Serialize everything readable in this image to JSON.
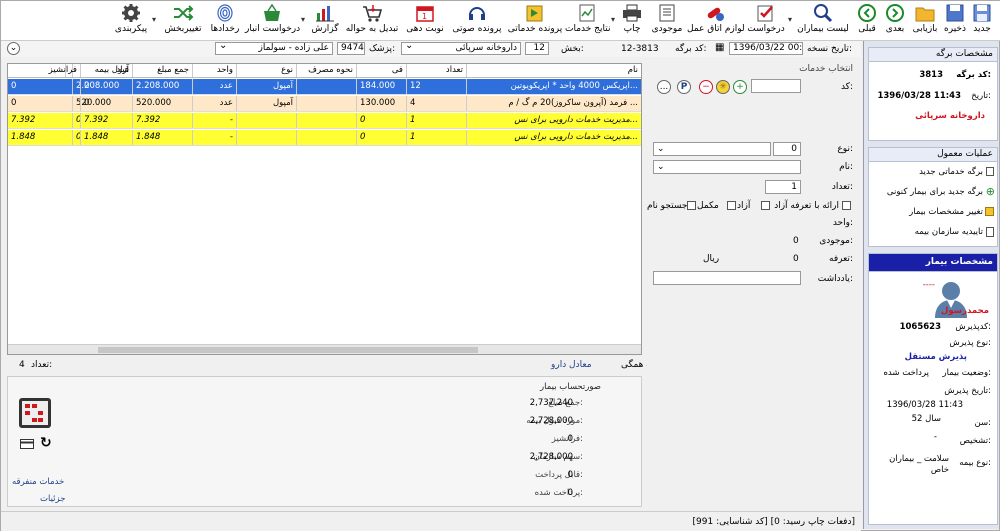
{
  "toolbar": {
    "items": [
      {
        "label": "جدید",
        "icon": "new-icon"
      },
      {
        "label": "ذخیره",
        "icon": "save-icon"
      },
      {
        "label": "بازیابی",
        "icon": "folder-icon"
      },
      {
        "label": "بعدی",
        "icon": "next-icon"
      },
      {
        "label": "قبلی",
        "icon": "previous-icon"
      },
      {
        "label": "لیست بیماران",
        "icon": "search-icon"
      },
      {
        "label": "درخواست",
        "icon": "request-icon"
      },
      {
        "label": "لوازم اتاق عمل",
        "icon": "pills-icon"
      },
      {
        "label": "موجودی",
        "icon": "inventory-icon"
      },
      {
        "label": "چاپ",
        "icon": "print-icon"
      },
      {
        "label": "نتایج خدمات",
        "icon": "results-icon"
      },
      {
        "label": "پرونده خدماتی",
        "icon": "service-file-icon"
      },
      {
        "label": "پرونده صوتی",
        "icon": "headset-icon"
      },
      {
        "label": "نوبت دهی",
        "icon": "calendar-icon"
      },
      {
        "label": "تبدیل به حواله",
        "icon": "cart-icon"
      },
      {
        "label": "گزارش",
        "icon": "chart-icon"
      },
      {
        "label": "درخواست انبار",
        "icon": "basket-icon"
      },
      {
        "label": "رخدادها",
        "icon": "fingerprint-icon"
      },
      {
        "label": "تغییربخش",
        "icon": "shuffle-icon"
      },
      {
        "label": "پیکربندی",
        "icon": "gear-icon"
      }
    ]
  },
  "header": {
    "version_date_label": "تاریخ نسخه:",
    "version_date": "1396/03/22 00:00",
    "sheet_code_label": "کد برگه:",
    "sheet_code": "12-3813",
    "ward_label": "بخش:",
    "ward_code": "12",
    "ward_name": "داروخانه سرپائی",
    "doctor_label": "پزشک:",
    "doctor_code": "9474",
    "doctor_name": "علی زاده - سولماز"
  },
  "grid": {
    "columns": [
      "نام",
      "تعداد",
      "فی",
      "نحوه مصرف",
      "نوع",
      "واحد",
      "جمع مبلغ",
      "قبول بیمه",
      "آزاد",
      "فرانشیز"
    ],
    "rows": [
      {
        "name": "اپریکس 4000 واحد * اپریکویوتین...",
        "count": "12",
        "price": "184.000",
        "usage": "",
        "type": "",
        "unit": "",
        "total": "2.208.000",
        "insurance": "2.208.000",
        "free": "0",
        "franchise": "0",
        "style": "selected"
      },
      {
        "name": "فرمد (آپرون ساکروز)20 م گ / م ...",
        "count": "4",
        "price": "130.000",
        "usage": "",
        "type": "آمپول",
        "unit": "عدد",
        "total": "520.000",
        "insurance": "520.000",
        "free": "0",
        "franchise": "0",
        "style": "peach"
      },
      {
        "name": "مدیریت خدمات دارویی برای نس...",
        "count": "1",
        "price": "0",
        "usage": "",
        "type": "",
        "unit": "-",
        "total": "7.392",
        "insurance": "0",
        "free": "7.392",
        "franchise": "7.392",
        "style": "yellow"
      },
      {
        "name": "مدیریت خدمات دارویی برای نس...",
        "count": "1",
        "price": "0",
        "usage": "",
        "type": "",
        "unit": "-",
        "total": "1.848",
        "insurance": "0",
        "free": "1.848",
        "franchise": "1.848",
        "style": "yellow"
      }
    ],
    "first_row_type": "آمپول",
    "first_row_unit": "عدد"
  },
  "below_grid": {
    "count_label": "تعداد:",
    "count_value": "4",
    "delete_all": "حذف همگی",
    "equivalent_drug": "معادل دارو"
  },
  "services": {
    "title": "انتخاب خدمات",
    "code_label": "کد:",
    "type_label": "نوع:",
    "type_value": "0",
    "name_label": "نام:",
    "qty_label": "تعداد:",
    "qty_value": "1",
    "chk_free_tariff": "ارائه با تعرفه آزاد",
    "chk_free": "آزاد",
    "chk_supplementary": "مکمل",
    "chk_name_search": "جستجو نام",
    "unit_label": "واحد:",
    "stock_label": "موجودی:",
    "stock_value": "0",
    "tariff_label": "تعرفه:",
    "tariff_value": "0",
    "currency": "ریال",
    "note_label": "یادداشت:",
    "btn_more": "...",
    "btn_p": "P"
  },
  "calc": {
    "title": "صورتحساب بیمار",
    "total_label": "جمع مبلغ:",
    "total": "2,737,240",
    "insured_label": "مورد قبول بیمه:",
    "insured": "2,728,000",
    "franchise_label": "فرانشیز:",
    "franchise": "0",
    "org_share_label": "سهم سازمان:",
    "org_share": "2,728,000",
    "payable_label": "قابل پرداخت:",
    "payable": "0",
    "paid_label": "پرداخت شده:",
    "paid": "0",
    "separate_services": "خدمات منفرقه",
    "details": "جزئیات"
  },
  "sheet_info": {
    "title": "مشخصات برگه",
    "code_label": "کد برگه:",
    "code": "3813",
    "date_label": "تاریخ:",
    "date": "1396/03/28 11:43",
    "pharmacy": "داروخانه سرپائی"
  },
  "common_ops": {
    "title": "عملیات معمول",
    "items": [
      "برگه خدماتی جدید",
      "برگه جدید برای بیمار کنونی",
      "تغییر مشخصات بیمار",
      "تاییدیه سازمان بیمه"
    ]
  },
  "patient": {
    "title": "مشخصات بیمار",
    "dashes": "----",
    "name": "محمدرسول",
    "admission_code_label": "کدپذیرش:",
    "admission_code": "1065623",
    "admission_type_label": "نوع پذیرش:",
    "admission_type": "پذیرش مستقل",
    "status_label": "وضعیت بیمار:",
    "status": "پرداخت شده",
    "admission_date_label": "تاریخ پذیرش:",
    "admission_date": "1396/03/28 11:43",
    "age_label": "سن:",
    "age": "52 سال",
    "diagnosis_label": "تشخیص:",
    "diagnosis": "-",
    "insurance_label": "نوع بیمه:",
    "insurance": "سلامت _ بیماران خاص"
  },
  "status_bar": {
    "text": "[کد شناسایی: 991]  [دفعات چاپ رسید: 0]"
  },
  "colors": {
    "selected_row": "#2f6fdb",
    "peach_row": "#ffe8c8",
    "yellow_row": "#ffff33",
    "side_header": "#1a1fa8",
    "red_text": "#d0161e"
  }
}
